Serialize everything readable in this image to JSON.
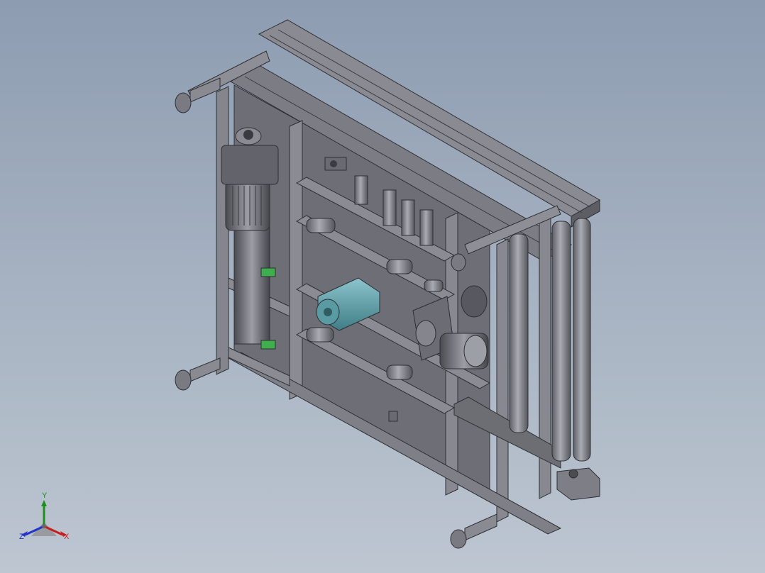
{
  "viewport": {
    "background_top": "#8d9cb1",
    "background_bottom": "#bdc6d1",
    "model_color": "#74757c",
    "model_edge_color": "#2e2f33",
    "cylinder_accent_color": "#5a9aa3",
    "motor_accent_color": "#3fae4d"
  },
  "triad": {
    "y_label": "Y",
    "x_label": "X",
    "z_label": "Z",
    "y_color": "#1d8f1d",
    "x_color": "#c81d1d",
    "z_color": "#2235c8"
  }
}
